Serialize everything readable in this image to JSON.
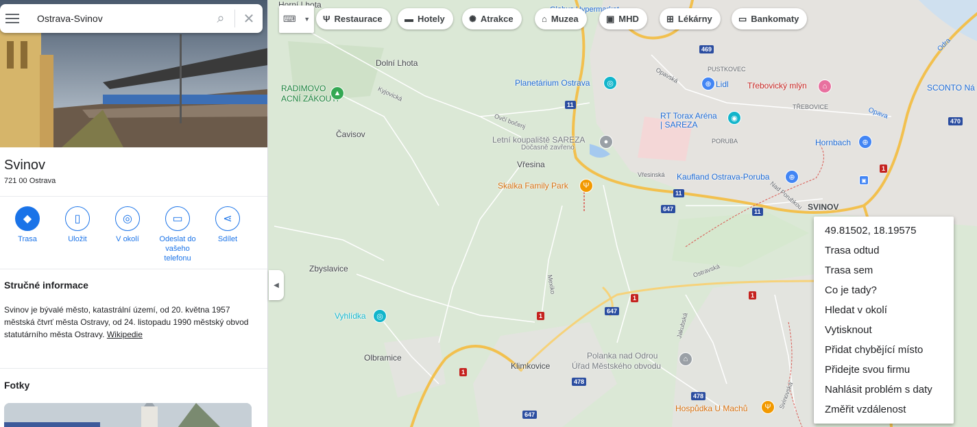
{
  "search": {
    "query": "Ostrava-Svinov"
  },
  "place": {
    "name": "Svinov",
    "address": "721 00 Ostrava",
    "actions": [
      {
        "label": "Trasa",
        "icon": "directions-icon"
      },
      {
        "label": "Uložit",
        "icon": "bookmark-icon"
      },
      {
        "label": "V okolí",
        "icon": "nearby-icon"
      },
      {
        "label": "Odeslat do vašeho telefonu",
        "icon": "send-to-phone-icon"
      },
      {
        "label": "Sdílet",
        "icon": "share-icon"
      }
    ],
    "info_heading": "Stručné informace",
    "info_text": "Svinov je bývalé město, katastrální území, od 20. května 1957 městská čtvrť města Ostravy, od 24. listopadu 1990 městský obvod statutárního města Ostravy.",
    "info_link": "Wikipedie",
    "photos_heading": "Fotky"
  },
  "chips": [
    {
      "label": "Restaurace",
      "icon": "restaurant-icon"
    },
    {
      "label": "Hotely",
      "icon": "hotel-icon"
    },
    {
      "label": "Atrakce",
      "icon": "attractions-icon"
    },
    {
      "label": "Muzea",
      "icon": "museum-icon"
    },
    {
      "label": "MHD",
      "icon": "transit-icon"
    },
    {
      "label": "Lékárny",
      "icon": "pharmacy-icon"
    },
    {
      "label": "Bankomaty",
      "icon": "atm-icon"
    }
  ],
  "map_labels": {
    "horni_lhota": "Horní Lhota",
    "dolni_lhota": "Dolní Lhota",
    "radimovo_1": "RADIMOVO",
    "radimovo_2": "ACNÍ ZÁKOUTÍ",
    "kyjovicka": "Kyjovická",
    "cavisov": "Čavisov",
    "planetarium": "Planetárium Ostrava",
    "globus": "Globus Hypermarket",
    "letni_1": "Letní koupaliště SAREZA",
    "letni_2": "Dočasně zavřeno",
    "vresina": "Vřesina",
    "skalka": "Skalka Family Park",
    "opavska": "Opavská",
    "pustkovec": "PUSTKOVEC",
    "lidl": "Lidl",
    "trebovicky": "Třebovický mlýn",
    "trebovice": "TŘEBOVICE",
    "rt_torax_1": "RT Torax Aréna",
    "rt_torax_2": "| SAREZA",
    "poruba": "PORUBA",
    "hornbach": "Hornbach",
    "kaufland": "Kaufland Ostrava-Poruba",
    "vresinska": "Vřesinská",
    "svinov": "SVINOV",
    "sconto": "SCONTO Ná",
    "odra": "Odra",
    "opava": "Opava",
    "zbyslavice": "Zbyslavice",
    "vyhlidka": "Vyhlídka",
    "olbramice": "Olbramice",
    "klimkovice": "Klimkovice",
    "polanka_1": "Polanka nad Odrou",
    "polanka_2": "Úřad Městského obvodu",
    "hospudka": "Hospůdka U Machů",
    "ostravska": "Ostravská",
    "mexico": "Mexiko",
    "jakubska": "Jakubská",
    "svinovska": "Svinovská",
    "nad_porubkou": "Nad Porubkou",
    "ovcinec": "Ovčí bočenj"
  },
  "road_shields": {
    "r11a": "11",
    "r11b": "11",
    "r11c": "11",
    "r469": "469",
    "r470": "470",
    "r647a": "647",
    "r647b": "647",
    "r647c": "647",
    "r478a": "478",
    "r478b": "478",
    "r1a": "1",
    "r1b": "1",
    "r1c": "1",
    "r1d": "1",
    "r1e": "1"
  },
  "context_menu": {
    "coords": "49.81502, 18.19575",
    "items": [
      "Trasa odtud",
      "Trasa sem",
      "Co je tady?",
      "Hledat v okolí",
      "Vytisknout",
      "Přidat chybějící místo",
      "Přidejte svou firmu",
      "Nahlásit problém s daty",
      "Změřit vzdálenost"
    ]
  }
}
